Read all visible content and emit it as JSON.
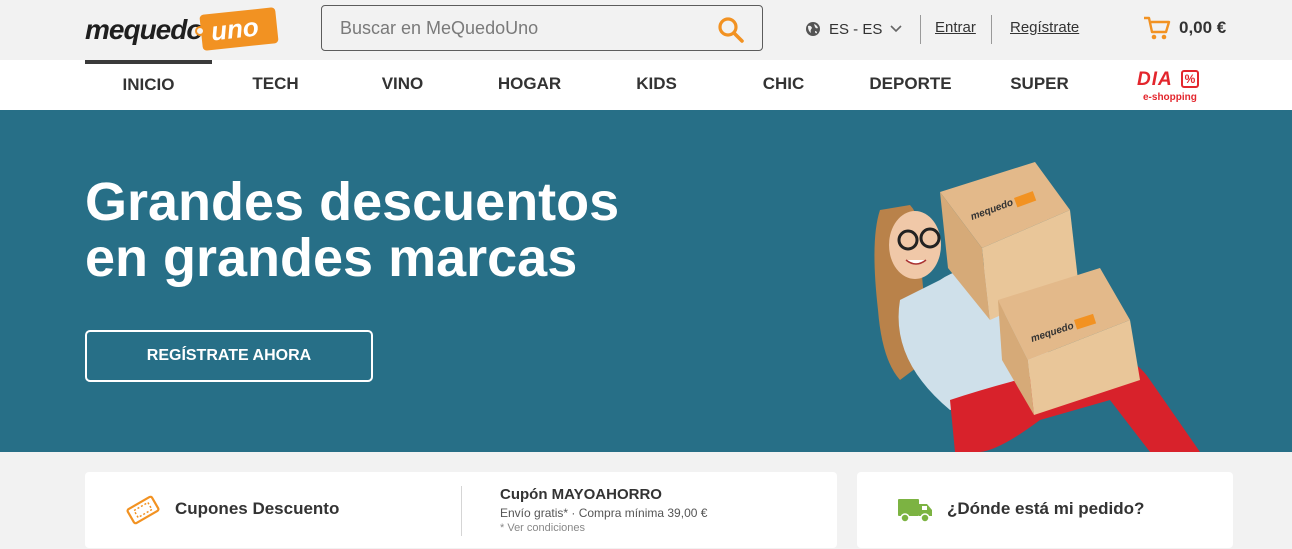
{
  "header": {
    "logo_word": "mequedo",
    "logo_tag": "uno",
    "search_placeholder": "Buscar en MeQuedoUno",
    "language": "ES - ES",
    "login": "Entrar",
    "register": "Regístrate",
    "cart_total": "0,00 €"
  },
  "nav": {
    "items": [
      "INICIO",
      "TECH",
      "VINO",
      "HOGAR",
      "KIDS",
      "CHIC",
      "DEPORTE",
      "SUPER"
    ],
    "dia_word": "DIA",
    "dia_symbol": "%",
    "dia_sub": "e-shopping"
  },
  "hero": {
    "title_line1": "Grandes descuentos",
    "title_line2": "en grandes marcas",
    "cta": "REGÍSTRATE AHORA",
    "box_logo": "mequedo uno"
  },
  "cards": {
    "coupons_label": "Cupones Descuento",
    "coupon_title": "Cupón MAYOAHORRO",
    "coupon_sub": "Envío gratis* · Compra mínima 39,00 €",
    "coupon_note": "* Ver condiciones",
    "order_label": "¿Dónde está mi pedido?"
  },
  "colors": {
    "accent": "#f29222",
    "hero_bg": "#276f87",
    "dia_red": "#e3262d",
    "truck_green": "#7cb342"
  }
}
